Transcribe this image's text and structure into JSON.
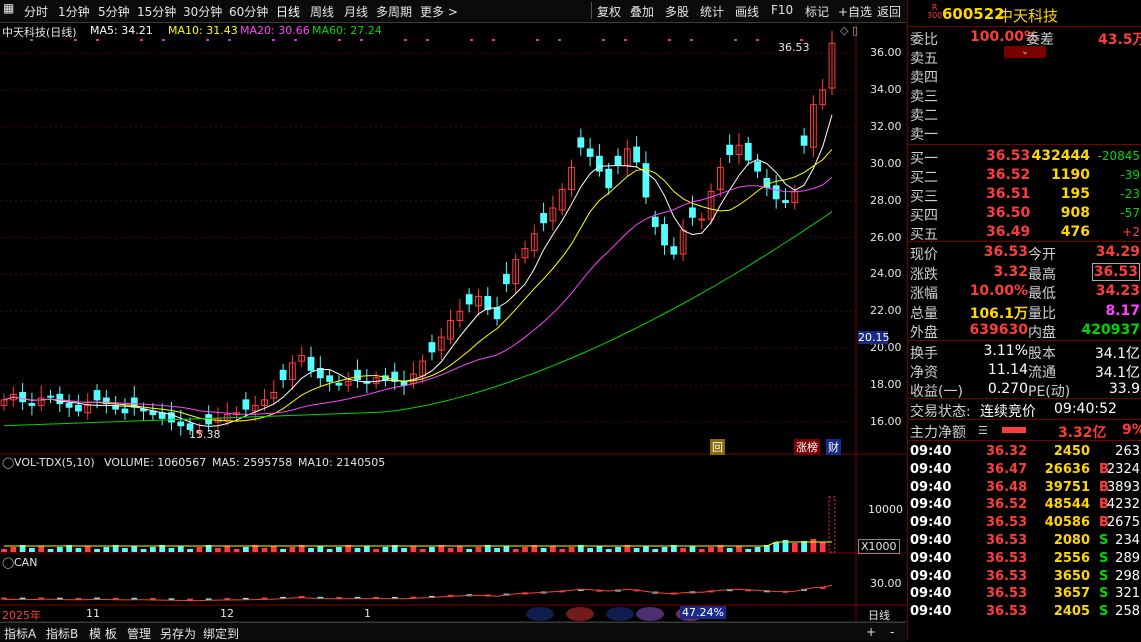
{
  "toolbar": {
    "left": [
      "分时",
      "1分钟",
      "5分钟",
      "15分钟",
      "30分钟",
      "60分钟",
      "日线",
      "周线",
      "月线",
      "多周期",
      "更多 >"
    ],
    "right": [
      "复权",
      "叠加",
      "多股",
      "统计",
      "画线",
      "F10",
      "标记",
      "+自选",
      "返回"
    ]
  },
  "header": {
    "stock_label": "中天科技(日线)",
    "ma5": "MA5: 34.21",
    "ma10": "MA10: 31.43",
    "ma20": "MA20: 30.66",
    "ma60": "MA60: 27.24"
  },
  "price_axis": [
    "36.00",
    "34.00",
    "32.00",
    "30.00",
    "28.00",
    "26.00",
    "24.00",
    "22.00",
    "20.00",
    "18.00",
    "16.00"
  ],
  "price_marker": "20.15",
  "annotations": {
    "high": "36.53",
    "low": "15.38",
    "huishu": "回",
    "zhangbang": "涨榜",
    "cai": "财"
  },
  "vol_header": {
    "name": "VOL-TDX(5,10)",
    "volume": "VOLUME: 1060567",
    "ma5": "MA5: 2595758",
    "ma10": "MA10: 2140505"
  },
  "vol_axis": {
    "tick": "10000",
    "unit": "X1000"
  },
  "can_header": {
    "name": "CAN"
  },
  "can_axis": {
    "tick": "30.00"
  },
  "date_axis": [
    "2025年",
    "11",
    "12",
    "1"
  ],
  "progress": "47.24%",
  "period_label": "日线",
  "bottom_tabs": [
    "指标A",
    "指标B",
    "模 板",
    "管理",
    "另存为",
    "绑定到"
  ],
  "bottom_right": [
    "+",
    "-"
  ],
  "chart_data": {
    "type": "candlestick",
    "ylim": [
      15,
      37
    ],
    "closes": [
      17.2,
      17.5,
      17.1,
      16.9,
      17.3,
      17.4,
      17.0,
      16.8,
      16.6,
      16.9,
      17.2,
      17.0,
      16.7,
      16.5,
      16.8,
      16.6,
      16.4,
      16.2,
      16.0,
      15.8,
      15.6,
      15.5,
      15.9,
      16.2,
      16.4,
      16.5,
      16.7,
      16.9,
      17.2,
      17.6,
      18.3,
      19.2,
      19.6,
      18.8,
      18.4,
      18.2,
      18.0,
      18.2,
      18.3,
      18.1,
      18.4,
      18.3,
      18.2,
      18.0,
      18.6,
      19.3,
      19.8,
      20.6,
      21.5,
      22.0,
      22.4,
      22.8,
      22.1,
      21.6,
      23.5,
      24.8,
      25.4,
      26.2,
      26.8,
      27.6,
      28.6,
      29.8,
      30.9,
      30.4,
      29.6,
      28.7,
      29.9,
      30.8,
      30.1,
      28.2,
      26.6,
      25.6,
      25.1,
      26.4,
      27.1,
      27.0,
      28.5,
      29.8,
      30.5,
      31.0,
      30.2,
      29.6,
      28.7,
      28.1,
      27.9,
      28.5,
      31.0,
      33.2,
      34.0,
      36.53
    ],
    "ma_lines": [
      "MA5",
      "MA10",
      "MA20",
      "MA60"
    ],
    "low": 15.38,
    "high": 36.53
  },
  "panel": {
    "code": "600522",
    "name": "中天科技",
    "badge_top": "R",
    "badge_bottom": "300",
    "weibi_label": "委比",
    "weibi_val": "100.00%",
    "weicha_label": "委差",
    "weicha_val": "43.5万",
    "sells": [
      "卖五",
      "卖四",
      "卖三",
      "卖二",
      "卖一"
    ],
    "buys": [
      {
        "label": "买一",
        "price": "36.53",
        "vol": "432444",
        "chg": "-20845"
      },
      {
        "label": "买二",
        "price": "36.52",
        "vol": "1190",
        "chg": "-39"
      },
      {
        "label": "买三",
        "price": "36.51",
        "vol": "195",
        "chg": "-23"
      },
      {
        "label": "买四",
        "price": "36.50",
        "vol": "908",
        "chg": "-57"
      },
      {
        "label": "买五",
        "price": "36.49",
        "vol": "476",
        "chg": "+2"
      }
    ],
    "stats": [
      {
        "l1": "现价",
        "v1": "36.53",
        "l2": "今开",
        "v2": "34.29"
      },
      {
        "l1": "涨跌",
        "v1": "3.32",
        "l2": "最高",
        "v2": "36.53"
      },
      {
        "l1": "涨幅",
        "v1": "10.00%",
        "l2": "最低",
        "v2": "34.23"
      },
      {
        "l1": "总量",
        "v1": "106.1万",
        "l2": "量比",
        "v2": "8.17"
      },
      {
        "l1": "外盘",
        "v1": "639630",
        "l2": "内盘",
        "v2": "420937"
      }
    ],
    "stats2": [
      {
        "l1": "换手",
        "v1": "3.11%",
        "l2": "股本",
        "v2": "34.1亿"
      },
      {
        "l1": "净资",
        "v1": "11.14",
        "l2": "流通",
        "v2": "34.1亿"
      },
      {
        "l1": "收益(一)",
        "v1": "0.270",
        "l2": "PE(动)",
        "v2": "33.9"
      }
    ],
    "trade_status_label": "交易状态:",
    "trade_status": "连续竞价",
    "trade_time": "09:40:52",
    "main_flow_label": "主力净额",
    "main_flow_val": "3.32亿",
    "main_flow_pct": "9%",
    "ticks": [
      {
        "t": "09:40",
        "p": "36.32",
        "v": "2450",
        "s": "",
        "n": "263"
      },
      {
        "t": "09:40",
        "p": "36.47",
        "v": "26636",
        "s": "B",
        "n": "2324"
      },
      {
        "t": "09:40",
        "p": "36.48",
        "v": "39751",
        "s": "B",
        "n": "3893"
      },
      {
        "t": "09:40",
        "p": "36.52",
        "v": "48544",
        "s": "B",
        "n": "4232"
      },
      {
        "t": "09:40",
        "p": "36.53",
        "v": "40586",
        "s": "B",
        "n": "2675"
      },
      {
        "t": "09:40",
        "p": "36.53",
        "v": "2080",
        "s": "S",
        "n": "234"
      },
      {
        "t": "09:40",
        "p": "36.53",
        "v": "2556",
        "s": "S",
        "n": "289"
      },
      {
        "t": "09:40",
        "p": "36.53",
        "v": "3650",
        "s": "S",
        "n": "298"
      },
      {
        "t": "09:40",
        "p": "36.53",
        "v": "3657",
        "s": "S",
        "n": "321"
      },
      {
        "t": "09:40",
        "p": "36.53",
        "v": "2405",
        "s": "S",
        "n": "258"
      }
    ]
  },
  "colors": {
    "up": "#ff3c3c",
    "down": "#54ffff",
    "ma5": "#ffffff",
    "ma10": "#ffff00",
    "ma20": "#ff44ff",
    "ma60": "#00d600"
  }
}
